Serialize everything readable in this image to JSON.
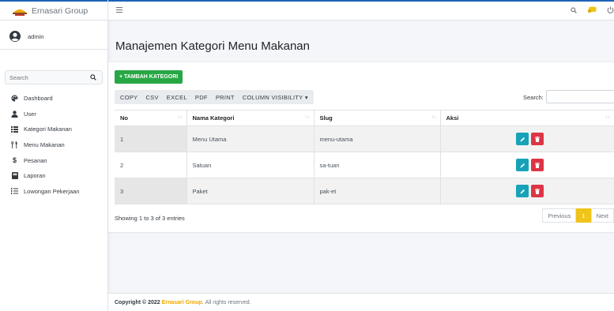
{
  "brand": {
    "name": "Ernasari Group"
  },
  "user": {
    "name": "admin"
  },
  "sidebar": {
    "search_placeholder": "Search",
    "items": [
      {
        "label": "Dashboard",
        "icon": "palette-icon"
      },
      {
        "label": "User",
        "icon": "user-icon"
      },
      {
        "label": "Kategori Makanan",
        "icon": "list-icon"
      },
      {
        "label": "Menu Makanan",
        "icon": "utensils-icon"
      },
      {
        "label": "Pesanan",
        "icon": "dollar-icon"
      },
      {
        "label": "Laporan",
        "icon": "book-icon"
      },
      {
        "label": "Lowongan Pekerjaan",
        "icon": "list-ol-icon"
      }
    ]
  },
  "page": {
    "title": "Manajemen Kategori Menu Makanan"
  },
  "toolbar": {
    "add_label": "+ TAMBAH KATEGORI",
    "buttons": [
      "COPY",
      "CSV",
      "EXCEL",
      "PDF",
      "PRINT",
      "COLUMN VISIBILITY ▾"
    ],
    "search_label": "Search:"
  },
  "table": {
    "headers": [
      "No",
      "Nama Kategori",
      "Slug",
      "Aksi"
    ],
    "rows": [
      {
        "no": "1",
        "nama": "Menu Utama",
        "slug": "menu-utama"
      },
      {
        "no": "2",
        "nama": "Satuan",
        "slug": "sa-tuan"
      },
      {
        "no": "3",
        "nama": "Paket",
        "slug": "pak-et"
      }
    ]
  },
  "pagination": {
    "info": "Showing 1 to 3 of 3 entries",
    "previous": "Previous",
    "current": "1",
    "next": "Next"
  },
  "footer": {
    "prefix": "Copyright © 2022",
    "brand": "Ernasari Group.",
    "suffix": "All rights reserved."
  },
  "colors": {
    "primary": "#1c63b7",
    "success": "#28a745",
    "info": "#17a2b8",
    "danger": "#dc3545",
    "warning": "#f0c419"
  }
}
